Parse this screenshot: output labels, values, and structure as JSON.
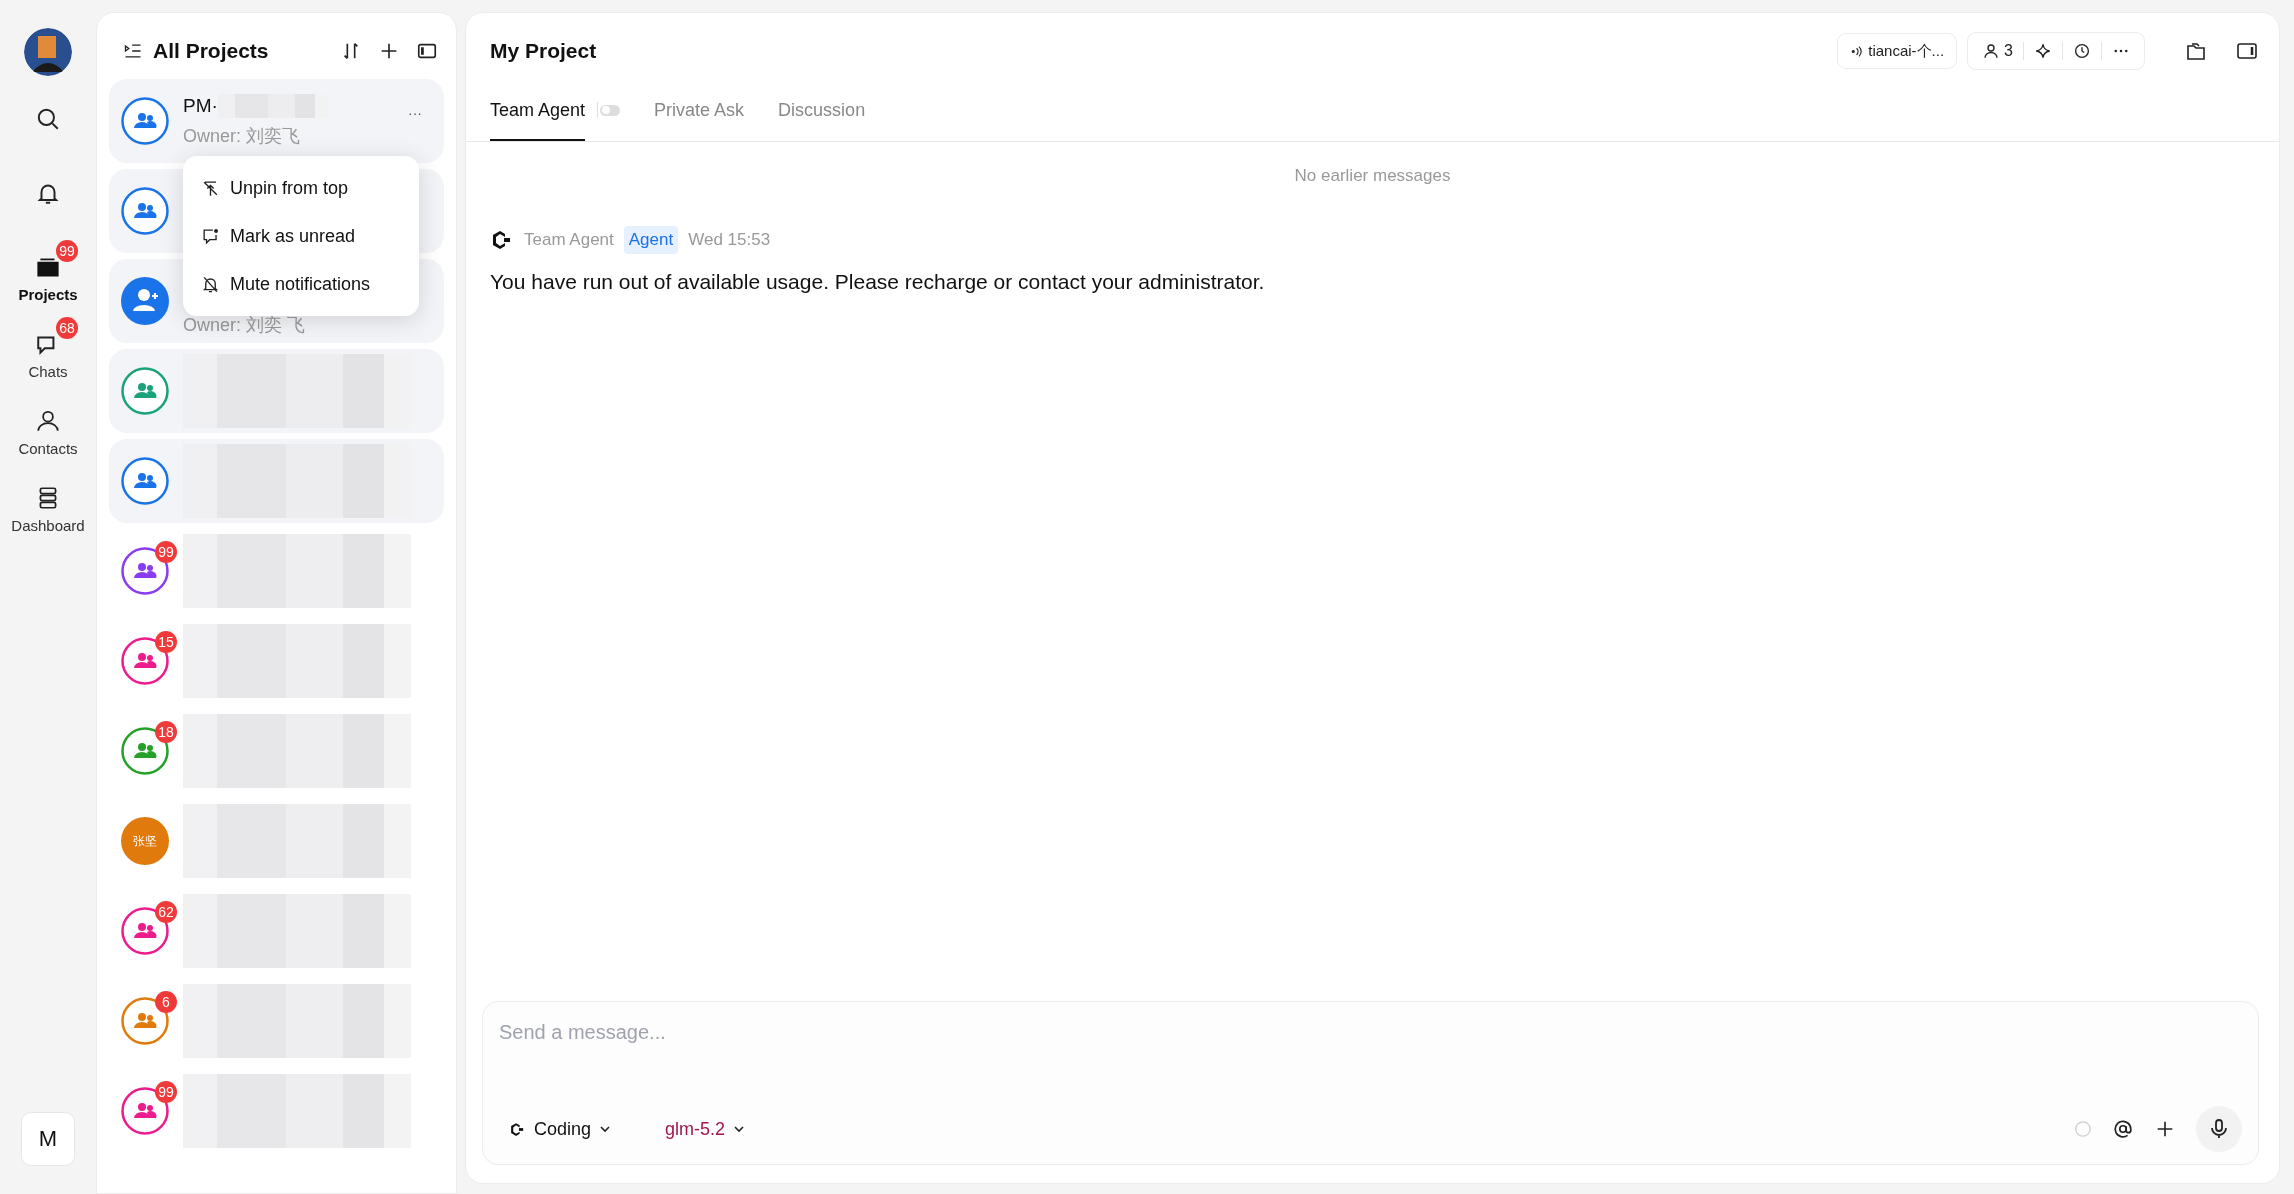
{
  "nav": [
    {
      "kind": "search",
      "selected": false
    },
    {
      "kind": "notifications",
      "selected": false
    },
    {
      "kind": "projects",
      "label": "Projects",
      "badge": "99",
      "selected": true
    },
    {
      "kind": "chats",
      "label": "Chats",
      "badge": "68",
      "selected": false
    },
    {
      "kind": "contacts",
      "label": "Contacts",
      "selected": false
    },
    {
      "kind": "dashboard",
      "label": "Dashboard",
      "selected": false
    }
  ],
  "user_initial": "M",
  "list": {
    "title": "All Projects",
    "projects": [
      {
        "kind": "ring",
        "color": "#1a73e8",
        "pinned": true,
        "title": "PM·",
        "owner": "Owner: 刘奕飞",
        "blurred": true,
        "more": "···"
      },
      {
        "kind": "ring",
        "color": "#1a73e8",
        "pinned": true
      },
      {
        "kind": "solid",
        "color": "#1a73e8",
        "pinned": true,
        "owner": "Owner: 刘奕 飞"
      },
      {
        "kind": "ring",
        "color": "#1aa37a",
        "pinned": true,
        "blurred": true
      },
      {
        "kind": "ring",
        "color": "#1a73e8",
        "pinned": true,
        "blurred": true
      },
      {
        "kind": "ring",
        "color": "#8a3cf0",
        "pinned": false,
        "badge": "99",
        "blurred": true
      },
      {
        "kind": "ring",
        "color": "#ec1c8c",
        "pinned": false,
        "badge": "15",
        "blurred": true
      },
      {
        "kind": "ring",
        "color": "#25a12a",
        "pinned": false,
        "badge": "18",
        "blurred": true
      },
      {
        "kind": "initials",
        "color": "#e07a0c",
        "pinned": false,
        "initials": "张坚",
        "blurred": true
      },
      {
        "kind": "ring",
        "color": "#ec1c8c",
        "pinned": false,
        "badge": "62",
        "blurred": true
      },
      {
        "kind": "ring",
        "color": "#e07a0c",
        "pinned": false,
        "badge": "6",
        "blurred": true
      },
      {
        "kind": "ring",
        "color": "#ec1c8c",
        "pinned": false,
        "badge": "99",
        "blurred": true
      }
    ]
  },
  "context_menu": [
    {
      "kind": "unpin",
      "label": "Unpin from top"
    },
    {
      "kind": "unread",
      "label": "Mark as unread"
    },
    {
      "kind": "mute",
      "label": "Mute notifications"
    }
  ],
  "main": {
    "title": "My Project",
    "channel": "tiancai-个...",
    "member_count": "3",
    "tabs": [
      {
        "label": "Team Agent",
        "selected": true
      },
      {
        "label": "Private Ask",
        "selected": false
      },
      {
        "label": "Discussion",
        "selected": false
      }
    ],
    "agent_toggle": {
      "on": false
    },
    "notice": "No earlier messages",
    "message": {
      "sender": "Team Agent",
      "tag": "Agent",
      "time": "Wed 15:53",
      "text": "You have run out of available usage. Please recharge or contact your administrator."
    },
    "composer": {
      "placeholder": "Send a message...",
      "mode": "Coding",
      "model": "glm-5.2"
    }
  }
}
